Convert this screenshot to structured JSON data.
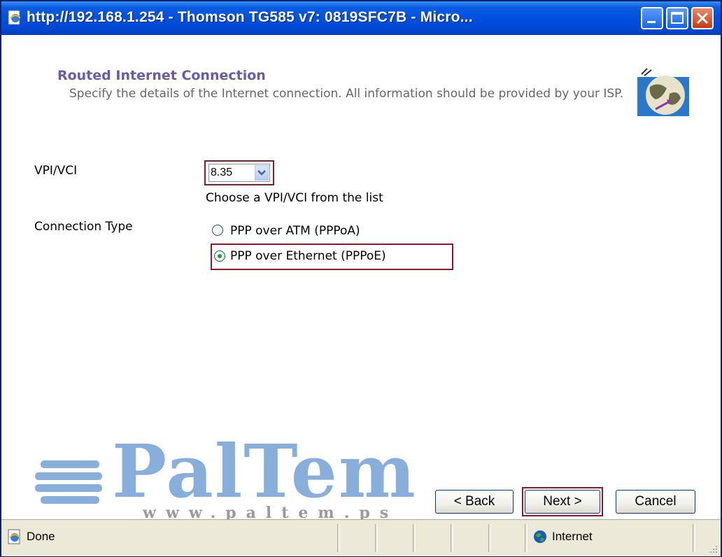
{
  "window": {
    "title": "http://192.168.1.254 - Thomson TG585 v7:  0819SFC7B - Micro..."
  },
  "page": {
    "heading": "Routed Internet Connection",
    "description": "Specify the details of the Internet connection. All information should be provided by your ISP."
  },
  "form": {
    "vpi_label": "VPI/VCI",
    "vpi_value": "8.35",
    "vpi_hint": "Choose a VPI/VCI from the list",
    "connection_type_label": "Connection Type",
    "options": [
      {
        "label": "PPP over ATM (PPPoA)",
        "selected": false
      },
      {
        "label": "PPP over Ethernet (PPPoE)",
        "selected": true
      }
    ]
  },
  "buttons": {
    "back": "< Back",
    "next": "Next >",
    "cancel": "Cancel"
  },
  "watermark": {
    "text": "PalTem",
    "url": "www.paltem.ps"
  },
  "statusbar": {
    "status": "Done",
    "zone": "Internet"
  },
  "colors": {
    "highlight_outline": "#8b1a2a",
    "heading": "#6b5aa8",
    "titlebar": "#0050e0"
  }
}
